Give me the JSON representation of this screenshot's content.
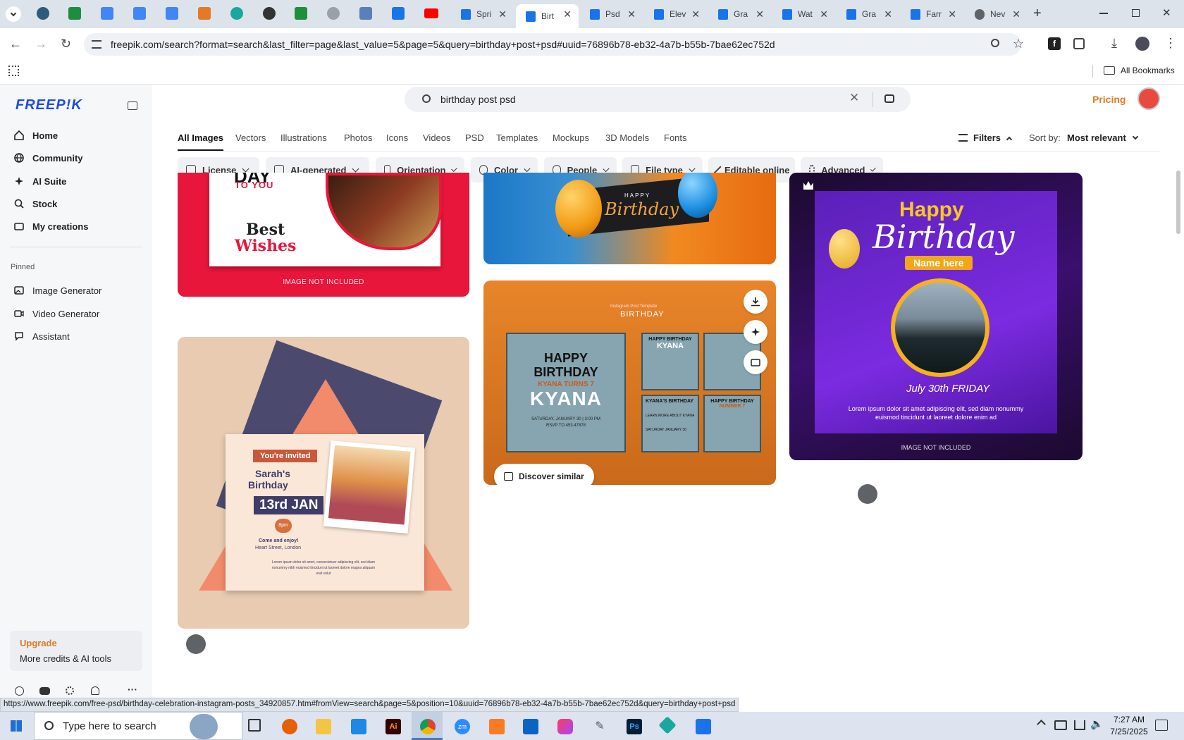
{
  "browser": {
    "tabs": [
      {
        "title": "Spri",
        "color": "#1a73e8"
      },
      {
        "title": "Birt",
        "color": "#1a73e8",
        "active": true
      },
      {
        "title": "Psd",
        "color": "#1a73e8"
      },
      {
        "title": "Elev",
        "color": "#1a73e8"
      },
      {
        "title": "Gra",
        "color": "#1a73e8"
      },
      {
        "title": "Wat",
        "color": "#1a73e8"
      },
      {
        "title": "Gra",
        "color": "#1a73e8"
      },
      {
        "title": "Farr",
        "color": "#1a73e8"
      },
      {
        "title": "Nev",
        "color": "#5f6368"
      }
    ],
    "url": "freepik.com/search?format=search&last_filter=page&last_value=5&page=5&query=birthday+post+psd#uuid=76896b78-eb32-4a7b-b55b-7bae62ec752d",
    "bookmarks_label": "All Bookmarks",
    "status_url": "https://www.freepik.com/free-psd/birthday-celebration-instagram-posts_34920857.htm#fromView=search&page=5&position=10&uuid=76896b78-eb32-4a7b-b55b-7bae62ec752d&query=birthday+post+psd"
  },
  "sidebar": {
    "logo": "FREEP!K",
    "nav": [
      {
        "label": "Home",
        "icon": "home-icon"
      },
      {
        "label": "Community",
        "icon": "globe-icon"
      },
      {
        "label": "AI Suite",
        "icon": "sparkle-icon"
      },
      {
        "label": "Stock",
        "icon": "search-icon"
      },
      {
        "label": "My creations",
        "icon": "folder-icon"
      }
    ],
    "pinned_label": "Pinned",
    "pinned": [
      {
        "label": "Image Generator",
        "icon": "image-icon"
      },
      {
        "label": "Video Generator",
        "icon": "video-icon"
      },
      {
        "label": "Assistant",
        "icon": "chat-icon"
      }
    ],
    "upgrade": {
      "title": "Upgrade",
      "subtitle": "More credits & AI tools"
    }
  },
  "search": {
    "query": "birthday post psd"
  },
  "header": {
    "pricing": "Pricing"
  },
  "categories": [
    "All Images",
    "Vectors",
    "Illustrations",
    "Photos",
    "Icons",
    "Videos",
    "PSD",
    "Templates",
    "Mockups",
    "3D Models",
    "Fonts"
  ],
  "filters_label": "Filters",
  "sort": {
    "label": "Sort by:",
    "value": "Most relevant"
  },
  "chips": [
    "License",
    "AI-generated",
    "Orientation",
    "Color",
    "People",
    "File type",
    "Editable online",
    "Advanced"
  ],
  "cards": {
    "c1": {
      "t1": "DAY",
      "t2": "TO YOU",
      "t3": "Best",
      "t4": "Wishes",
      "note": "IMAGE NOT INCLUDED"
    },
    "c2": {
      "t1": "HAPPY",
      "t2": "Birthday"
    },
    "c3": {
      "t1": "Happy",
      "t2": "Birthday",
      "t3": "Name here",
      "t4": "July 30th FRIDAY",
      "t5": "Lorem ipsum dolor sit amet adipiscing elit, sed diam nonummy",
      "t6": "euismod tincidunt ut laoreet dolore enim ad",
      "note": "IMAGE NOT INCLUDED"
    },
    "c4": {
      "t0": "Instagram Post Template",
      "t1": "BIRTHDAY",
      "t2": "HAPPY",
      "t3": "BIRTHDAY",
      "t4": "KYANA TURNS 7",
      "t5": "KYANA",
      "t6": "SATURDAY, JANUARY 30 | 3:00 PM",
      "t7": "RSVP TO 453.47878",
      "t8": "HAPPY BIRTHDAY",
      "t9": "KYANA",
      "t10": "KYANA'S BIRTHDAY",
      "t11": "HAPPY BIRTHDAY",
      "t12": "NUMBER 7",
      "t13": "LEARN MORE ABOUT KYANA",
      "t14": "SATURDAY JANUARY 30",
      "discover": "Discover similar"
    },
    "c5": {
      "t1": "You're invited",
      "t2": "Sarah's",
      "t3": "Birthday",
      "t4": "13rd JAN",
      "t5": "8pm",
      "t6": "Come and enjoy!",
      "t7": "Heart Street, London",
      "t8": "Lorem ipsum dolor sit amet, consectetuer adipiscing elit, sed diam",
      "t9": "nonummy nibh euismod tincidunt ut laoreet dolore magna aliquam",
      "t10": "erat volut"
    }
  },
  "taskbar": {
    "search_placeholder": "Type here to search",
    "time": "7:27 AM",
    "date": "7/25/2025"
  }
}
